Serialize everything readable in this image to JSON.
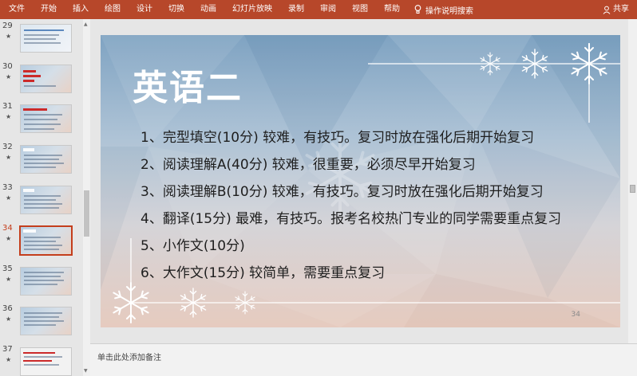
{
  "ribbon": {
    "tabs": [
      "文件",
      "开始",
      "插入",
      "绘图",
      "设计",
      "切换",
      "动画",
      "幻灯片放映",
      "录制",
      "审阅",
      "视图",
      "帮助"
    ],
    "search_label": "操作说明搜索",
    "share_label": "共享"
  },
  "thumbnails": [
    {
      "number": "29",
      "star": "★"
    },
    {
      "number": "30",
      "star": "★"
    },
    {
      "number": "31",
      "star": "★"
    },
    {
      "number": "32",
      "star": "★"
    },
    {
      "number": "33",
      "star": "★"
    },
    {
      "number": "34",
      "star": "★"
    },
    {
      "number": "35",
      "star": "★"
    },
    {
      "number": "36",
      "star": "★"
    },
    {
      "number": "37",
      "star": "★"
    }
  ],
  "selected_slide": "34",
  "slide": {
    "title": "英语二",
    "items": [
      "1、完型填空(10分) 较难，有技巧。复习时放在强化后期开始复习",
      "2、阅读理解A(40分) 较难，很重要，必须尽早开始复习",
      "3、阅读理解B(10分) 较难，有技巧。复习时放在强化后期开始复习",
      "4、翻译(15分) 最难，有技巧。报考名校热门专业的同学需要重点复习",
      "5、小作文(10分)",
      "6、大作文(15分) 较简单，需要重点复习"
    ],
    "page_number": "34"
  },
  "notes": {
    "placeholder": "单击此处添加备注"
  },
  "colors": {
    "ribbon": "#b7472a",
    "selected": "#c43e1c"
  }
}
